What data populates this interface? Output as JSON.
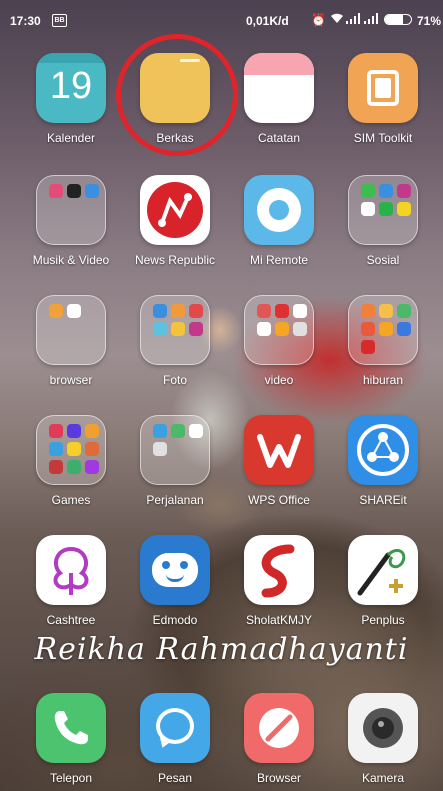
{
  "status_bar": {
    "time": "17:30",
    "notification_badge": "BB",
    "net_speed": "0,01K/d",
    "battery_percent": "71%",
    "battery_level": 0.71
  },
  "row1": [
    {
      "label": "Kalender",
      "day": "19"
    },
    {
      "label": "Berkas"
    },
    {
      "label": "Catatan"
    },
    {
      "label": "SIM Toolkit"
    }
  ],
  "row2": [
    {
      "label": "Musik & Video"
    },
    {
      "label": "News Republic"
    },
    {
      "label": "Mi Remote"
    },
    {
      "label": "Sosial"
    }
  ],
  "row3": [
    {
      "label": "browser"
    },
    {
      "label": "Foto"
    },
    {
      "label": "video"
    },
    {
      "label": "hiburan"
    }
  ],
  "row4": [
    {
      "label": "Games"
    },
    {
      "label": "Perjalanan"
    },
    {
      "label": "WPS Office"
    },
    {
      "label": "SHAREit"
    }
  ],
  "row5": [
    {
      "label": "Cashtree"
    },
    {
      "label": "Edmodo"
    },
    {
      "label": "SholatKMJY"
    },
    {
      "label": "Penplus"
    }
  ],
  "signature": "Reikha Rahmadhayanti",
  "dock": [
    {
      "label": "Telepon"
    },
    {
      "label": "Pesan"
    },
    {
      "label": "Browser"
    },
    {
      "label": "Kamera"
    }
  ],
  "colors": {
    "highlight_circle": "#e0242c",
    "kalender": "#4bb9c3",
    "berkas": "#f0c35a",
    "sim_toolkit": "#f2a455",
    "news_republic": "#d8232a",
    "mi_remote": "#5bb8e8",
    "wps": "#d9382f",
    "shareit": "#2f8fe6",
    "telepon": "#4cc46f",
    "pesan": "#44a7e8",
    "browser": "#f06a6a"
  }
}
